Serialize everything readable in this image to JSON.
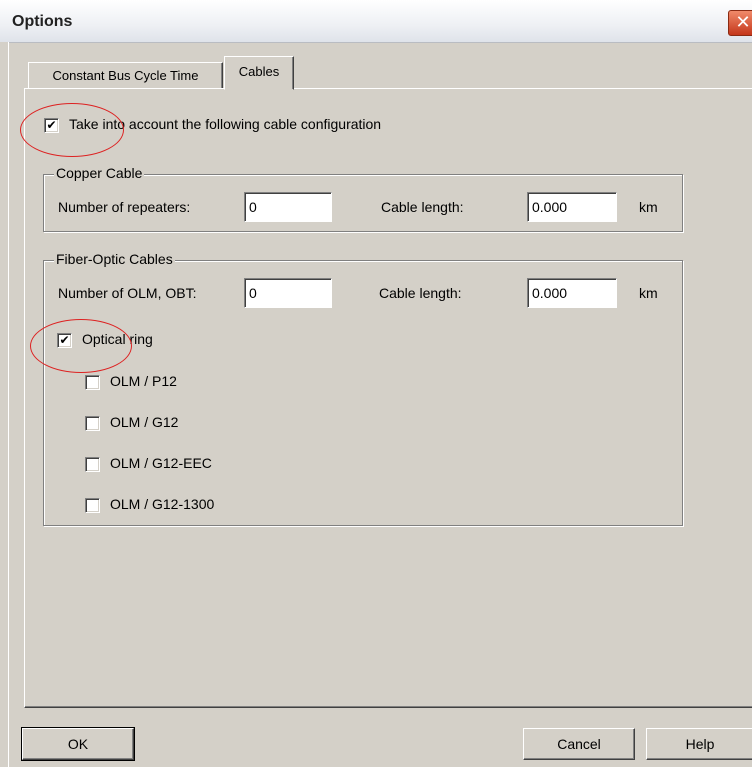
{
  "window": {
    "title": "Options",
    "close_glyph": "✕"
  },
  "tabs": [
    {
      "label": "Constant Bus Cycle Time",
      "active": false
    },
    {
      "label": "Cables",
      "active": true
    }
  ],
  "cable_config": {
    "label": "Take into account the following cable configuration",
    "checked": true,
    "check_glyph": "✔"
  },
  "copper": {
    "title": "Copper Cable",
    "repeaters_label": "Number of repeaters:",
    "repeaters_value": "0",
    "length_label": "Cable length:",
    "length_value": "0.000",
    "unit": "km"
  },
  "fiber": {
    "title": "Fiber-Optic Cables",
    "olm_label": "Number of OLM, OBT:",
    "olm_value": "0",
    "length_label": "Cable length:",
    "length_value": "0.000",
    "unit": "km",
    "optical_ring": {
      "label": "Optical ring",
      "checked": true,
      "check_glyph": "✔"
    },
    "options": [
      {
        "label": "OLM / P12",
        "checked": false
      },
      {
        "label": "OLM / G12",
        "checked": false
      },
      {
        "label": "OLM / G12-EEC",
        "checked": false
      },
      {
        "label": "OLM / G12-1300",
        "checked": false
      }
    ]
  },
  "buttons": {
    "ok": "OK",
    "cancel": "Cancel",
    "help": "Help"
  },
  "colors": {
    "annotation": "#dd2222",
    "dialog_bg": "#d4d0c8"
  }
}
